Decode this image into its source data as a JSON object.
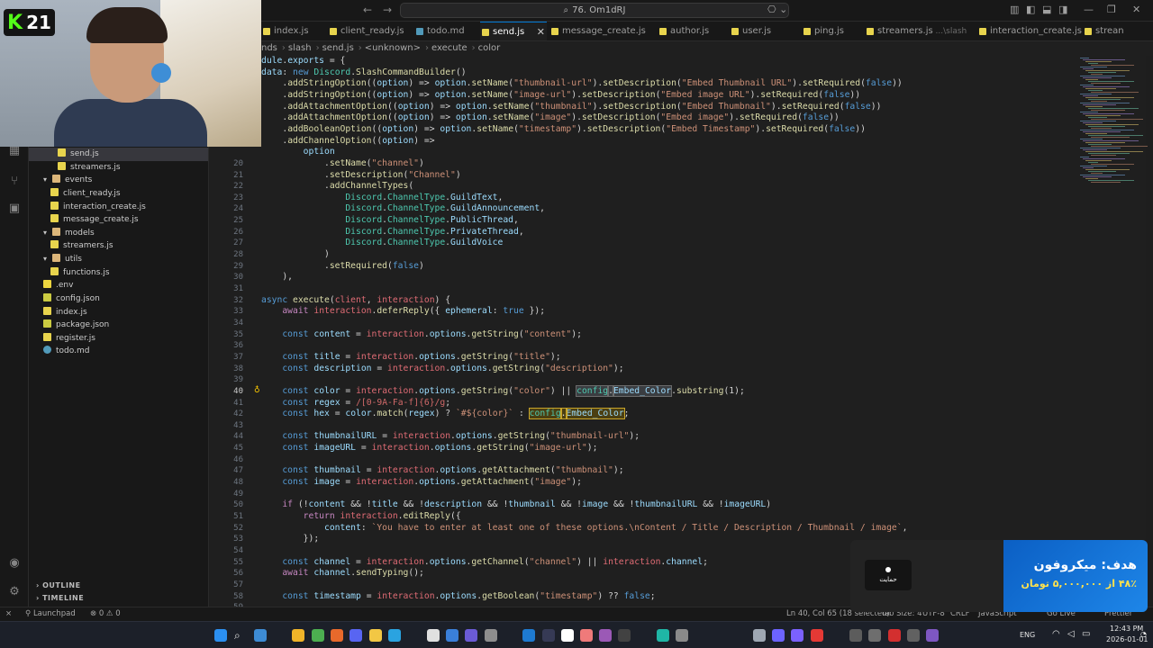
{
  "titlebar": {
    "search_text": "76. Om1dRJ",
    "back": "←",
    "forward": "→"
  },
  "streamer": {
    "logo_k": "K",
    "logo_number": "21"
  },
  "tabs": [
    {
      "label": "index.js",
      "icon": "js"
    },
    {
      "label": "client_ready.js",
      "icon": "js"
    },
    {
      "label": "todo.md",
      "icon": "md"
    },
    {
      "label": "send.js",
      "icon": "js",
      "active": true
    },
    {
      "label": "message_create.js",
      "icon": "js"
    },
    {
      "label": "author.js",
      "icon": "js"
    },
    {
      "label": "user.js",
      "icon": "js"
    },
    {
      "label": "ping.js",
      "icon": "js"
    },
    {
      "label": "streamers.js",
      "extra": "...\\slash",
      "icon": "js"
    },
    {
      "label": "interaction_create.js",
      "icon": "js"
    },
    {
      "label": "strean",
      "icon": "js"
    }
  ],
  "breadcrumb": [
    "nds",
    "slash",
    "send.js",
    "<unknown>",
    "execute",
    "color"
  ],
  "explorer": {
    "items": [
      {
        "label": "send.js",
        "type": "js",
        "indent": 3,
        "selected": true
      },
      {
        "label": "streamers.js",
        "type": "js",
        "indent": 3
      },
      {
        "label": "events",
        "type": "folder",
        "indent": 1,
        "open": true
      },
      {
        "label": "client_ready.js",
        "type": "js",
        "indent": 2
      },
      {
        "label": "interaction_create.js",
        "type": "js",
        "indent": 2
      },
      {
        "label": "message_create.js",
        "type": "js",
        "indent": 2
      },
      {
        "label": "models",
        "type": "folder",
        "indent": 1,
        "open": true
      },
      {
        "label": "streamers.js",
        "type": "js",
        "indent": 2
      },
      {
        "label": "utils",
        "type": "folder",
        "indent": 1,
        "open": true
      },
      {
        "label": "functions.js",
        "type": "js",
        "indent": 2
      },
      {
        "label": ".env",
        "type": "env",
        "indent": 1
      },
      {
        "label": "config.json",
        "type": "json",
        "indent": 1
      },
      {
        "label": "index.js",
        "type": "js",
        "indent": 1
      },
      {
        "label": "package.json",
        "type": "json",
        "indent": 1
      },
      {
        "label": "register.js",
        "type": "js",
        "indent": 1
      },
      {
        "label": "todo.md",
        "type": "md",
        "indent": 1
      }
    ],
    "outline": "OUTLINE",
    "timeline": "TIMELINE"
  },
  "editor": {
    "header_lines": [
      {
        "text": "dule.exports = {",
        "indent": 0
      },
      {
        "text": "data: new Discord.SlashCommandBuilder()",
        "indent": 1
      },
      {
        "text": ".addStringOption((option) => option.setName(\"thumbnail-url\").setDescription(\"Embed Thumbnail URL\").setRequired(false))",
        "indent": 2
      },
      {
        "text": ".addStringOption((option) => option.setName(\"image-url\").setDescription(\"Embed image URL\").setRequired(false))",
        "indent": 2
      },
      {
        "text": ".addAttachmentOption((option) => option.setName(\"thumbnail\").setDescription(\"Embed Thumbnail\").setRequired(false))",
        "indent": 2
      },
      {
        "text": ".addAttachmentOption((option) => option.setName(\"image\").setDescription(\"Embed image\").setRequired(false))",
        "indent": 2
      },
      {
        "text": ".addBooleanOption((option) => option.setName(\"timestamp\").setDescription(\"Embed Timestamp\").setRequired(false))",
        "indent": 2
      },
      {
        "text": ".addChannelOption((option) =>",
        "indent": 2
      },
      {
        "text": "option",
        "indent": 3
      }
    ],
    "lines": [
      {
        "n": "20",
        "text": ".setName(\"channel\")",
        "indent": 4
      },
      {
        "n": "21",
        "text": ".setDescription(\"Channel\")",
        "indent": 4
      },
      {
        "n": "22",
        "text": ".addChannelTypes(",
        "indent": 4
      },
      {
        "n": "23",
        "text": "Discord.ChannelType.GuildText,",
        "indent": 5
      },
      {
        "n": "24",
        "text": "Discord.ChannelType.GuildAnnouncement,",
        "indent": 5
      },
      {
        "n": "25",
        "text": "Discord.ChannelType.PublicThread,",
        "indent": 5
      },
      {
        "n": "26",
        "text": "Discord.ChannelType.PrivateThread,",
        "indent": 5
      },
      {
        "n": "27",
        "text": "Discord.ChannelType.GuildVoice",
        "indent": 5
      },
      {
        "n": "28",
        "text": ")",
        "indent": 4
      },
      {
        "n": "29",
        "text": ".setRequired(false)",
        "indent": 4
      },
      {
        "n": "30",
        "text": "),",
        "indent": 2
      },
      {
        "n": "31",
        "text": "",
        "indent": 0
      },
      {
        "n": "32",
        "text": "async execute(client, interaction) {",
        "indent": 1
      },
      {
        "n": "33",
        "text": "await interaction.deferReply({ ephemeral: true });",
        "indent": 2
      },
      {
        "n": "34",
        "text": "",
        "indent": 0
      },
      {
        "n": "35",
        "text": "const content = interaction.options.getString(\"content\");",
        "indent": 2
      },
      {
        "n": "36",
        "text": "",
        "indent": 0
      },
      {
        "n": "37",
        "text": "const title = interaction.options.getString(\"title\");",
        "indent": 2
      },
      {
        "n": "38",
        "text": "const description = interaction.options.getString(\"description\");",
        "indent": 2
      },
      {
        "n": "39",
        "text": "",
        "indent": 0
      },
      {
        "n": "40",
        "text": "const color = interaction.options.getString(\"color\") || config.Embed_Color.substring(1);",
        "indent": 2,
        "current": true
      },
      {
        "n": "41",
        "text": "const regex = /[0-9A-Fa-f]{6}/g;",
        "indent": 2
      },
      {
        "n": "42",
        "text": "const hex = color.match(regex) ? `#${color}` : config.Embed_Color;",
        "indent": 2
      },
      {
        "n": "43",
        "text": "",
        "indent": 0
      },
      {
        "n": "44",
        "text": "const thumbnailURL = interaction.options.getString(\"thumbnail-url\");",
        "indent": 2
      },
      {
        "n": "45",
        "text": "const imageURL = interaction.options.getString(\"image-url\");",
        "indent": 2
      },
      {
        "n": "46",
        "text": "",
        "indent": 0
      },
      {
        "n": "47",
        "text": "const thumbnail = interaction.options.getAttachment(\"thumbnail\");",
        "indent": 2
      },
      {
        "n": "48",
        "text": "const image = interaction.options.getAttachment(\"image\");",
        "indent": 2
      },
      {
        "n": "49",
        "text": "",
        "indent": 0
      },
      {
        "n": "50",
        "text": "if (!content && !title && !description && !thumbnail && !image && !thumbnailURL && !imageURL)",
        "indent": 2
      },
      {
        "n": "51",
        "text": "return interaction.editReply({",
        "indent": 3
      },
      {
        "n": "52",
        "text": "content: `You have to enter at least one of these options.\\nContent / Title / Description / Thumbnail / image`,",
        "indent": 4
      },
      {
        "n": "53",
        "text": "});",
        "indent": 3
      },
      {
        "n": "54",
        "text": "",
        "indent": 0
      },
      {
        "n": "55",
        "text": "const channel = interaction.options.getChannel(\"channel\") || interaction.channel;",
        "indent": 2
      },
      {
        "n": "56",
        "text": "await channel.sendTyping();",
        "indent": 2
      },
      {
        "n": "57",
        "text": "",
        "indent": 0
      },
      {
        "n": "58",
        "text": "const timestamp = interaction.options.getBoolean(\"timestamp\") ?? false;",
        "indent": 2
      },
      {
        "n": "59",
        "text": "",
        "indent": 0
      }
    ]
  },
  "donation": {
    "goal_text": "هدف: میکروفون",
    "amount_text": "۴۸٪ از ۵,۰۰۰,۰۰۰ تومان",
    "support_label": "حمایت",
    "progress_percent": 48
  },
  "statusbar": {
    "branch": "Launchpad",
    "problems": "⊗ 0  ⚠ 0",
    "cursor": "Ln 40, Col 65 (18 selected)",
    "tab_size": "Tab Size: 4",
    "encoding": "UTF-8",
    "eol": "CRLF",
    "language": "JavaScript",
    "golive": "Go Live",
    "prettier": "Prettier"
  },
  "taskbar": {
    "language": "ENG",
    "time": "12:43 PM",
    "date": "2026-01-01"
  },
  "colors": {
    "keyword": "#569cd6",
    "control": "#c586c0",
    "variable": "#9cdcfe",
    "function": "#dcdcaa",
    "string": "#ce9178",
    "type": "#4ec9b0",
    "regex": "#d16969",
    "object": "#e06c75"
  }
}
